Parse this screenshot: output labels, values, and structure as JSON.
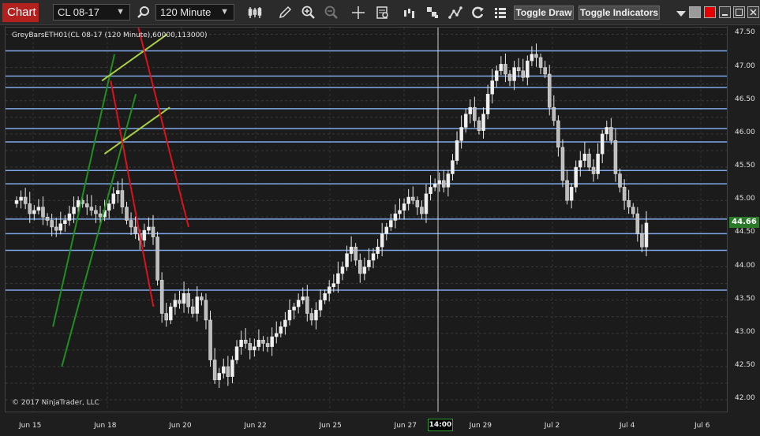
{
  "toolbar": {
    "chart_tab": "Chart",
    "instrument": "CL 08-17",
    "interval": "120 Minute",
    "toggle_draw": "Toggle Draw",
    "toggle_indicators": "Toggle Indicators",
    "icons": [
      "search-icon",
      "bar-type-icon",
      "pencil-icon",
      "zoom-in-icon",
      "zoom-out-icon",
      "crosshair-icon",
      "data-box-icon",
      "indicators-icon",
      "strategies-icon",
      "drawing-tools-icon",
      "reload-icon",
      "properties-icon"
    ]
  },
  "panel": {
    "label": "GreyBarsETH01(CL 08-17 (120 Minute),60000,113000)",
    "copyright": "© 2017 NinjaTrader, LLC"
  },
  "price_axis": {
    "labels": [
      "47.50",
      "47.00",
      "46.50",
      "46.00",
      "45.50",
      "45.00",
      "44.50",
      "44.00",
      "43.50",
      "43.00",
      "42.50",
      "42.00"
    ],
    "last_price": "44.66"
  },
  "time_axis": {
    "labels": [
      {
        "text": "Jun 15"
      },
      {
        "text": "Jun 18"
      },
      {
        "text": "Jun 20"
      },
      {
        "text": "Jun 22"
      },
      {
        "text": "Jun 25"
      },
      {
        "text": "Jun 27"
      },
      {
        "text": "Jun 29"
      },
      {
        "text": "Jul 2"
      },
      {
        "text": "Jul 4"
      },
      {
        "text": "Jul 6"
      }
    ],
    "crosshair_time": "14:00"
  },
  "colors": {
    "accent": "#b3211e",
    "horizontal_lines": "#7fa8e8",
    "green_channel": "#1f8f1f",
    "yellow_channel": "#a8d040",
    "red_channel": "#e0101a",
    "last_price_bg": "#2a7a2a"
  },
  "chart_data": {
    "type": "candlestick",
    "price_min": 41.8,
    "price_max": 47.6,
    "horizontal_levels": [
      47.25,
      46.87,
      46.7,
      46.38,
      46.08,
      45.88,
      45.45,
      45.25,
      44.72,
      44.5,
      44.25,
      43.65
    ],
    "channels": [
      {
        "color": "green",
        "lines": [
          [
            [
              42.2,
              43.1
            ],
            [
              47.1,
              47.2
            ]
          ],
          [
            [
              42.9,
              42.5
            ],
            [
              48.8,
              46.6
            ]
          ]
        ]
      },
      {
        "color": "yellow",
        "lines": [
          [
            [
              46.1,
              46.8
            ],
            [
              51.3,
              47.5
            ]
          ],
          [
            [
              46.3,
              45.7
            ],
            [
              51.5,
              46.4
            ]
          ]
        ]
      },
      {
        "color": "red",
        "lines": [
          [
            [
              49.0,
              47.6
            ],
            [
              53.0,
              44.6
            ]
          ],
          [
            [
              46.8,
              46.8
            ],
            [
              50.2,
              43.4
            ]
          ]
        ]
      }
    ],
    "closes": [
      45.0,
      45.05,
      44.95,
      44.8,
      44.85,
      44.9,
      44.75,
      44.7,
      44.6,
      44.55,
      44.65,
      44.7,
      44.8,
      44.9,
      45.0,
      44.95,
      44.9,
      44.85,
      44.8,
      44.75,
      44.85,
      44.95,
      45.1,
      45.15,
      44.9,
      44.7,
      44.6,
      44.5,
      44.4,
      44.55,
      44.6,
      44.45,
      43.8,
      43.3,
      43.2,
      43.4,
      43.5,
      43.45,
      43.6,
      43.4,
      43.3,
      43.55,
      43.5,
      43.2,
      42.6,
      42.3,
      42.4,
      42.5,
      42.35,
      42.6,
      42.8,
      42.9,
      42.85,
      42.75,
      42.8,
      42.9,
      42.85,
      42.8,
      42.95,
      43.0,
      43.1,
      43.2,
      43.35,
      43.4,
      43.5,
      43.55,
      43.3,
      43.2,
      43.35,
      43.5,
      43.6,
      43.7,
      43.75,
      43.9,
      44.0,
      44.2,
      44.3,
      44.1,
      43.9,
      44.0,
      44.1,
      44.2,
      44.3,
      44.5,
      44.6,
      44.7,
      44.8,
      44.85,
      44.95,
      45.05,
      45.0,
      44.9,
      44.8,
      45.1,
      45.2,
      45.25,
      45.3,
      45.2,
      45.4,
      45.6,
      45.9,
      46.1,
      46.3,
      46.4,
      46.2,
      46.05,
      46.3,
      46.6,
      46.8,
      46.95,
      47.05,
      46.9,
      46.8,
      47.0,
      46.95,
      46.85,
      47.1,
      47.2,
      47.15,
      47.0,
      46.9,
      46.4,
      46.2,
      45.8,
      45.3,
      45.0,
      45.2,
      45.5,
      45.6,
      45.7,
      45.5,
      45.4,
      45.7,
      46.0,
      46.1,
      45.9,
      45.4,
      45.2,
      45.0,
      44.9,
      44.8,
      44.5,
      44.3,
      44.66
    ]
  }
}
